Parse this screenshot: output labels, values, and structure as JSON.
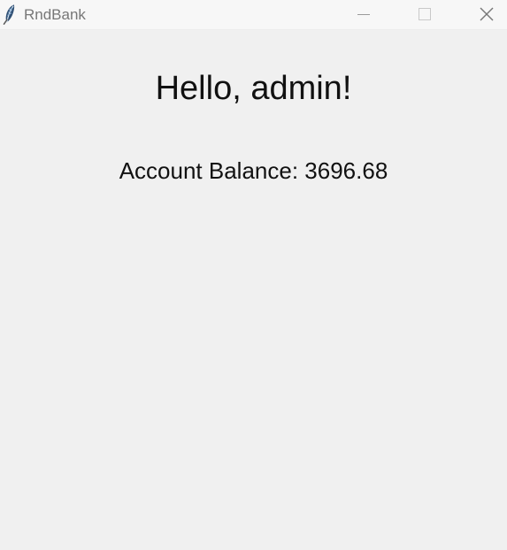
{
  "window": {
    "title": "RndBank",
    "icon": "feather-icon",
    "controls": [
      "minimize-icon",
      "maximize-icon",
      "close-icon"
    ]
  },
  "main": {
    "greeting": "Hello, admin!",
    "balance_label": "Account Balance:",
    "balance_value": "3696.68"
  }
}
